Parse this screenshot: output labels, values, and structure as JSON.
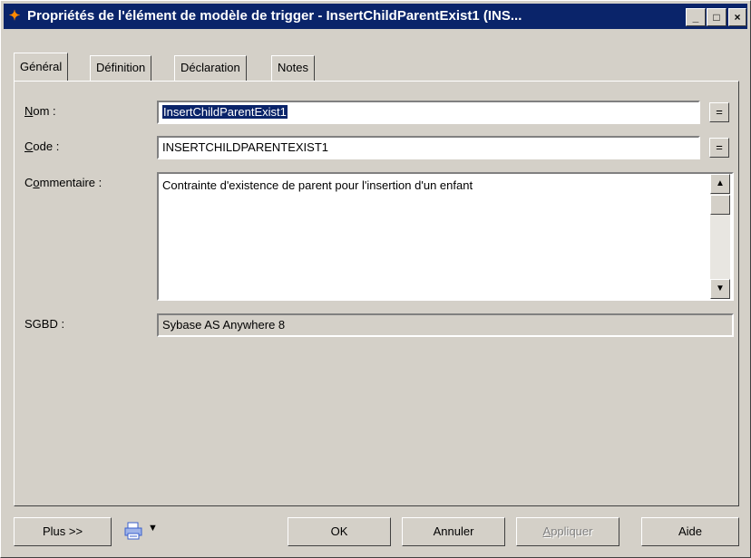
{
  "window": {
    "title": "Propriétés de l'élément de modèle de trigger - InsertChildParentExist1 (INS...",
    "controls": {
      "minimize": "_",
      "maximize": "□",
      "close": "×"
    }
  },
  "tabs": [
    {
      "label": "Général"
    },
    {
      "label": "Définition"
    },
    {
      "label": "Déclaration"
    },
    {
      "label": "Notes"
    }
  ],
  "form": {
    "nom": {
      "label_ul": "N",
      "label_rest": "om :",
      "value": "InsertChildParentExist1",
      "button": "="
    },
    "code": {
      "label_ul": "C",
      "label_rest": "ode :",
      "value": "INSERTCHILDPARENTEXIST1",
      "button": "="
    },
    "commentaire": {
      "label_pre": "C",
      "label_ul": "o",
      "label_rest": "mmentaire :",
      "value": "Contrainte d'existence de parent pour l'insertion d'un enfant"
    },
    "sgbd": {
      "label": "SGBD :",
      "value": "Sybase AS Anywhere 8"
    }
  },
  "footer": {
    "more": "Plus >>",
    "ok": "OK",
    "cancel": "Annuler",
    "apply_ul": "A",
    "apply_rest": "ppliquer",
    "help": "Aide"
  },
  "colors": {
    "titlebar": "#0a246a",
    "face": "#d4d0c8",
    "selection": "#0a246a"
  }
}
